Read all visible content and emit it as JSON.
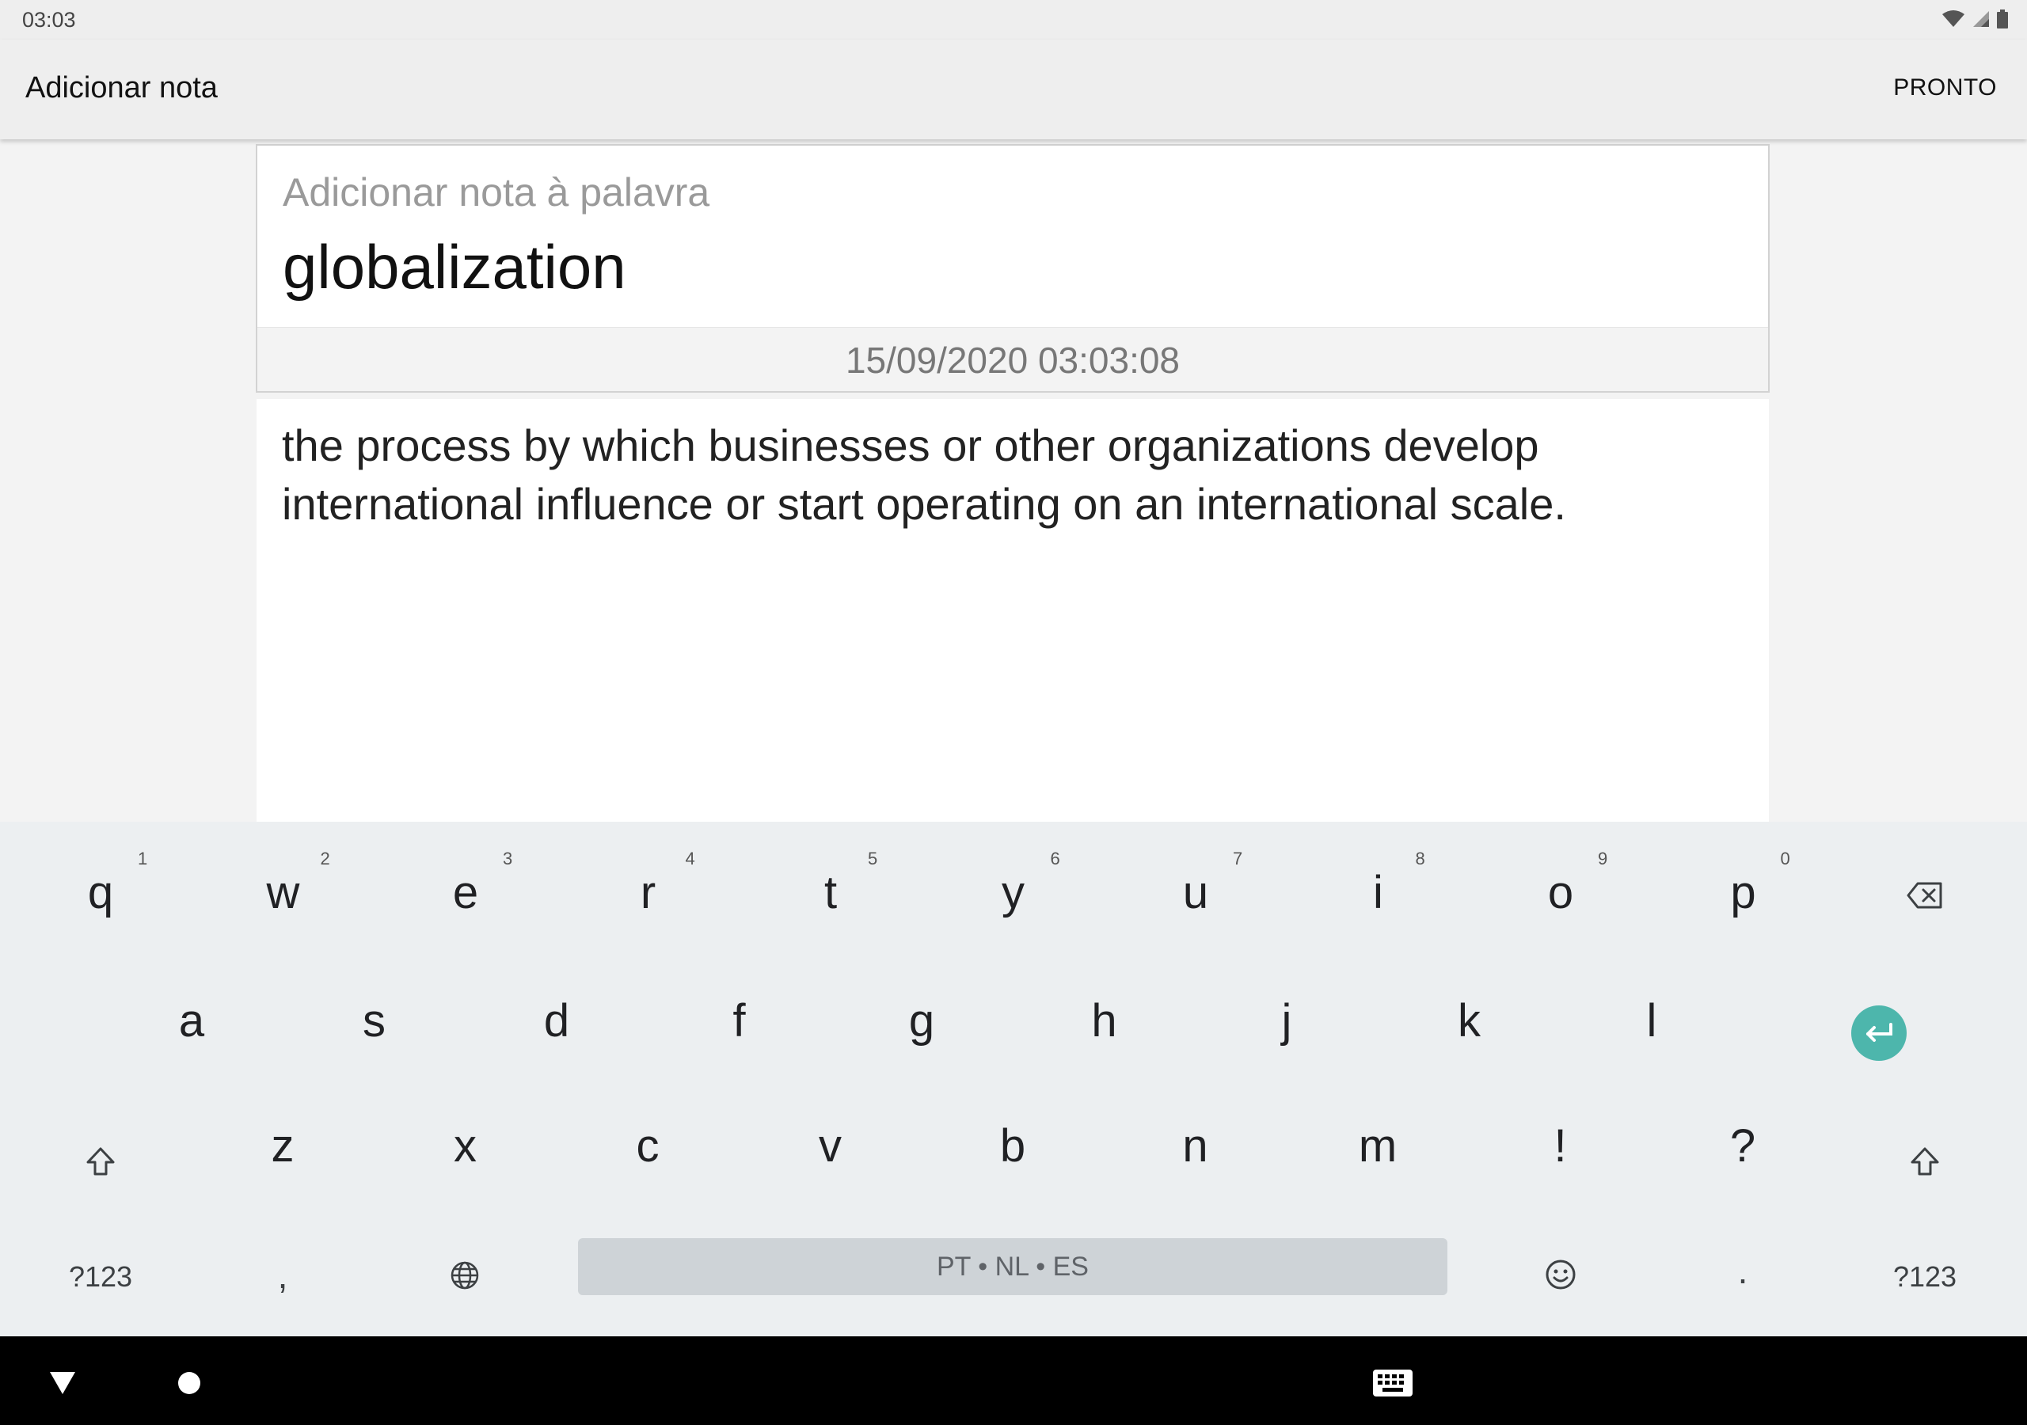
{
  "status_bar": {
    "time": "03:03"
  },
  "app_bar": {
    "title": "Adicionar nota",
    "done_label": "PRONTO"
  },
  "word_card": {
    "label": "Adicionar nota à palavra",
    "word": "globalization",
    "date": "15/09/2020 03:03:08"
  },
  "note": {
    "text": "the process by which businesses or other organizations develop\ninternational influence or start operating on an international scale."
  },
  "keyboard": {
    "row1": [
      {
        "label": "q",
        "hint": "1"
      },
      {
        "label": "w",
        "hint": "2"
      },
      {
        "label": "e",
        "hint": "3"
      },
      {
        "label": "r",
        "hint": "4"
      },
      {
        "label": "t",
        "hint": "5"
      },
      {
        "label": "y",
        "hint": "6"
      },
      {
        "label": "u",
        "hint": "7"
      },
      {
        "label": "i",
        "hint": "8"
      },
      {
        "label": "o",
        "hint": "9"
      },
      {
        "label": "p",
        "hint": "0"
      }
    ],
    "row2": [
      "a",
      "s",
      "d",
      "f",
      "g",
      "h",
      "j",
      "k",
      "l"
    ],
    "row3": [
      "z",
      "x",
      "c",
      "v",
      "b",
      "n",
      "m",
      "!",
      "?"
    ],
    "symbols_label": "?123",
    "comma": ",",
    "period": ".",
    "spacebar_label": "PT • NL • ES",
    "accent_color": "#4db6ac"
  }
}
